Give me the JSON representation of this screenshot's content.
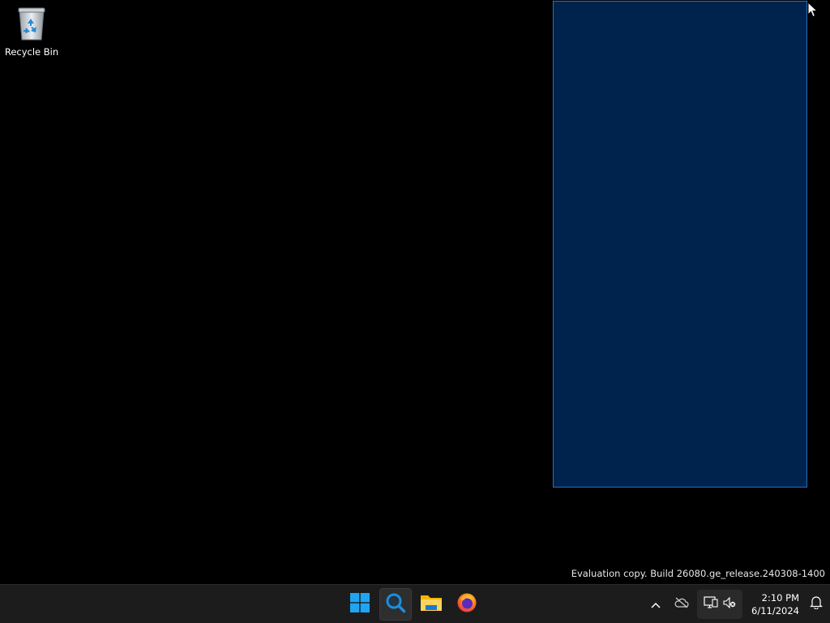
{
  "desktop": {
    "background_color": "#000000",
    "icons": [
      {
        "label": "Recycle Bin",
        "icon": "recycle-bin-icon"
      }
    ],
    "selection_color": "#00295a",
    "watermark": "Evaluation copy. Build 26080.ge_release.240308-1400"
  },
  "taskbar": {
    "background_color": "#1c1c1c",
    "pinned": [
      {
        "name": "start-button",
        "icon": "windows-logo-icon",
        "active": false
      },
      {
        "name": "search-button",
        "icon": "search-icon",
        "active": true
      },
      {
        "name": "file-explorer-button",
        "icon": "folder-icon",
        "active": false
      },
      {
        "name": "firefox-button",
        "icon": "firefox-icon",
        "active": false
      }
    ],
    "tray": {
      "icons": [
        "chevron-up-icon",
        "onedrive-offline-icon",
        "network-disconnected-icon",
        "volume-muted-icon",
        "notification-bell-icon"
      ],
      "time": "2:10 PM",
      "date": "6/11/2024"
    }
  }
}
